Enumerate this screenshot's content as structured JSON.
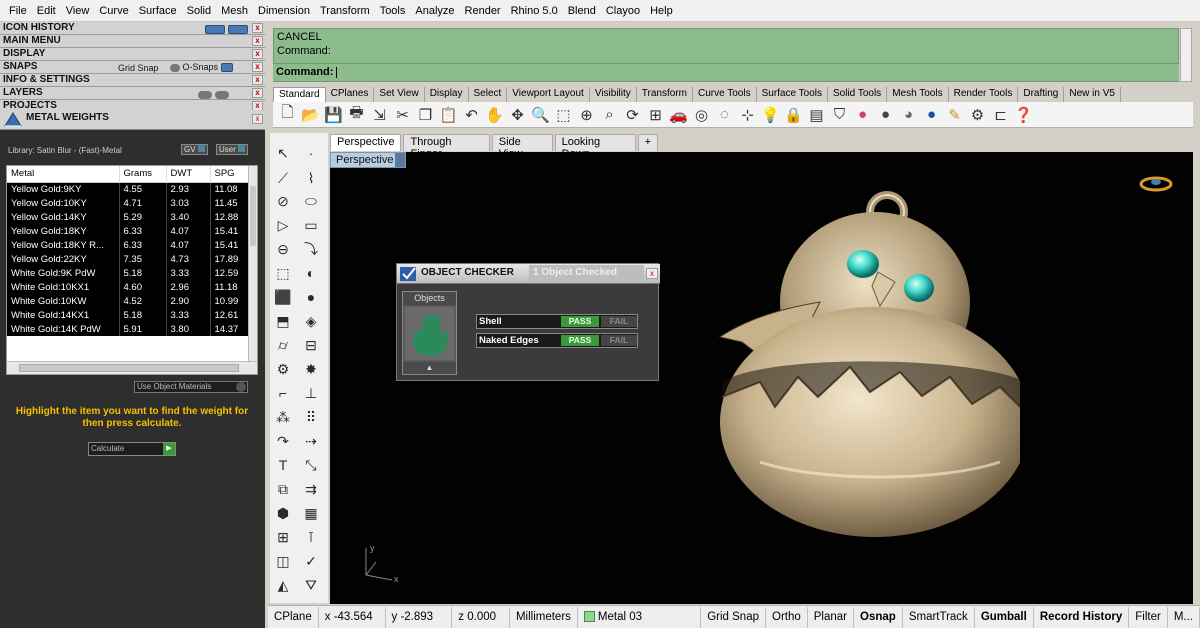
{
  "menu": [
    "File",
    "Edit",
    "View",
    "Curve",
    "Surface",
    "Solid",
    "Mesh",
    "Dimension",
    "Transform",
    "Tools",
    "Analyze",
    "Render",
    "Rhino 5.0",
    "Blend",
    "Clayoo",
    "Help"
  ],
  "panels": {
    "icon_history": "ICON HISTORY",
    "main_menu": "MAIN MENU",
    "display": "DISPLAY",
    "snaps": "SNAPS",
    "grid_snap": "Grid Snap",
    "osnaps": "O-Snaps",
    "info_settings": "INFO & SETTINGS",
    "layers": "LAYERS",
    "projects": "PROJECTS",
    "close_glyph": "x"
  },
  "metal_weights": {
    "title": "METAL WEIGHTS",
    "library": "Library: Satin Blur - (Fast)-Metal",
    "gv_label": "GV",
    "user_label": "User",
    "columns": [
      "Metal",
      "Grams",
      "DWT",
      "SPG"
    ],
    "rows": [
      [
        "Yellow Gold:9KY",
        "4.55",
        "2.93",
        "11.08"
      ],
      [
        "Yellow Gold:10KY",
        "4.71",
        "3.03",
        "11.45"
      ],
      [
        "Yellow Gold:14KY",
        "5.29",
        "3.40",
        "12.88"
      ],
      [
        "Yellow Gold:18KY",
        "6.33",
        "4.07",
        "15.41"
      ],
      [
        "Yellow Gold:18KY R...",
        "6.33",
        "4.07",
        "15.41"
      ],
      [
        "Yellow Gold:22KY",
        "7.35",
        "4.73",
        "17.89"
      ],
      [
        "White Gold:9K PdW",
        "5.18",
        "3.33",
        "12.59"
      ],
      [
        "White Gold:10KX1",
        "4.60",
        "2.96",
        "11.18"
      ],
      [
        "White Gold:10KW",
        "4.52",
        "2.90",
        "10.99"
      ],
      [
        "White Gold:14KX1",
        "5.18",
        "3.33",
        "12.61"
      ],
      [
        "White Gold:14K PdW",
        "5.91",
        "3.80",
        "14.37"
      ]
    ],
    "use_materials": "Use Object Materials",
    "hint": "Highlight the item you want to find the weight for then press calculate.",
    "calculate": "Calculate"
  },
  "command": {
    "line1": "CANCEL",
    "line2": "Command:",
    "prompt": "Command:"
  },
  "toolbar_tabs": [
    "Standard",
    "CPlanes",
    "Set View",
    "Display",
    "Select",
    "Viewport Layout",
    "Visibility",
    "Transform",
    "Curve Tools",
    "Surface Tools",
    "Solid Tools",
    "Mesh Tools",
    "Render Tools",
    "Drafting",
    "New in V5"
  ],
  "viewport_tabs": [
    "Perspective",
    "Through Finger",
    "Side View",
    "Looking Down",
    "+"
  ],
  "viewport_label": "Perspective",
  "checker": {
    "title": "OBJECT CHECKER",
    "count": "1  Object Checked",
    "objects_label": "Objects",
    "rows": [
      {
        "name": "Shell",
        "pass": "PASS",
        "fail": "FAIL"
      },
      {
        "name": "Naked Edges",
        "pass": "PASS",
        "fail": "FAIL"
      }
    ]
  },
  "axis": {
    "x": "x",
    "y": "y"
  },
  "status": {
    "cplane": "CPlane",
    "x": "x -43.564",
    "y": "y -2.893",
    "z": "z 0.000",
    "units": "Millimeters",
    "layer": "Metal 03",
    "grid_snap": "Grid Snap",
    "ortho": "Ortho",
    "planar": "Planar",
    "osnap": "Osnap",
    "smarttrack": "SmartTrack",
    "gumball": "Gumball",
    "record_history": "Record History",
    "filter": "Filter",
    "more": "M..."
  },
  "colors": {
    "command_bg": "#8cbc8c",
    "pass": "#3c9a3c",
    "hint": "#f5c000",
    "viewport_bg": "#020202"
  }
}
